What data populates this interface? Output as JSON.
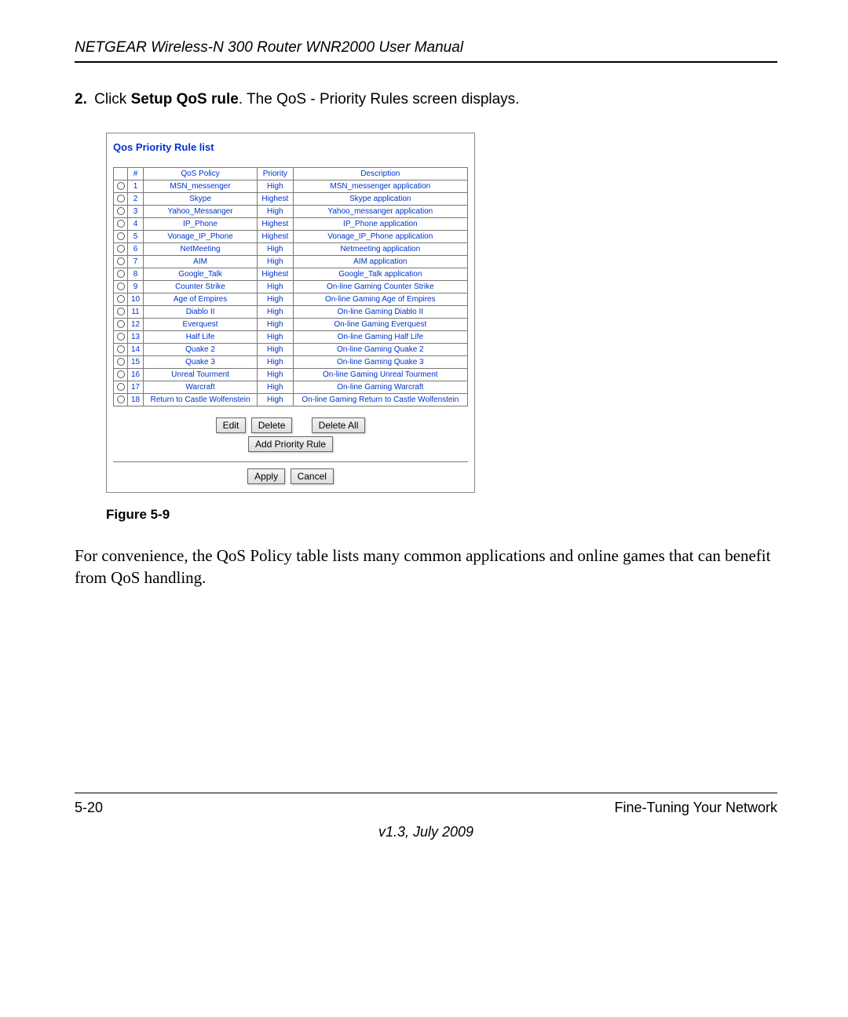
{
  "header": "NETGEAR Wireless-N 300 Router WNR2000 User Manual",
  "step": {
    "number": "2.",
    "lead": "Click ",
    "bold": "Setup QoS rule",
    "rest": ". The QoS - Priority Rules screen displays."
  },
  "panel": {
    "title": "Qos Priority Rule list",
    "columns": {
      "radio": "",
      "num": "#",
      "policy": "QoS Policy",
      "priority": "Priority",
      "desc": "Description"
    },
    "rows": [
      {
        "n": "1",
        "policy": "MSN_messenger",
        "priority": "High",
        "desc": "MSN_messenger application"
      },
      {
        "n": "2",
        "policy": "Skype",
        "priority": "Highest",
        "desc": "Skype application"
      },
      {
        "n": "3",
        "policy": "Yahoo_Messanger",
        "priority": "High",
        "desc": "Yahoo_messanger application"
      },
      {
        "n": "4",
        "policy": "IP_Phone",
        "priority": "Highest",
        "desc": "IP_Phone application"
      },
      {
        "n": "5",
        "policy": "Vonage_IP_Phone",
        "priority": "Highest",
        "desc": "Vonage_IP_Phone application"
      },
      {
        "n": "6",
        "policy": "NetMeeting",
        "priority": "High",
        "desc": "Netmeeting application"
      },
      {
        "n": "7",
        "policy": "AIM",
        "priority": "High",
        "desc": "AIM application"
      },
      {
        "n": "8",
        "policy": "Google_Talk",
        "priority": "Highest",
        "desc": "Google_Talk application"
      },
      {
        "n": "9",
        "policy": "Counter Strike",
        "priority": "High",
        "desc": "On-line Gaming Counter Strike"
      },
      {
        "n": "10",
        "policy": "Age of Empires",
        "priority": "High",
        "desc": "On-line Gaming Age of Empires"
      },
      {
        "n": "11",
        "policy": "Diablo II",
        "priority": "High",
        "desc": "On-line Gaming Diablo II"
      },
      {
        "n": "12",
        "policy": "Everquest",
        "priority": "High",
        "desc": "On-line Gaming Everquest"
      },
      {
        "n": "13",
        "policy": "Half Life",
        "priority": "High",
        "desc": "On-line Gaming Half Life"
      },
      {
        "n": "14",
        "policy": "Quake 2",
        "priority": "High",
        "desc": "On-line Gaming Quake 2"
      },
      {
        "n": "15",
        "policy": "Quake 3",
        "priority": "High",
        "desc": "On-line Gaming Quake 3"
      },
      {
        "n": "16",
        "policy": "Unreal Tourment",
        "priority": "High",
        "desc": "On-line Gaming Unreal Tourment"
      },
      {
        "n": "17",
        "policy": "Warcraft",
        "priority": "High",
        "desc": "On-line Gaming Warcraft"
      },
      {
        "n": "18",
        "policy": "Return to Castle Wolfenstein",
        "priority": "High",
        "desc": "On-line Gaming Return to Castle Wolfenstein"
      }
    ],
    "buttons": {
      "edit": "Edit",
      "delete": "Delete",
      "delete_all": "Delete All",
      "add": "Add Priority Rule",
      "apply": "Apply",
      "cancel": "Cancel"
    }
  },
  "figure_label": "Figure 5-9",
  "paragraph": "For convenience, the QoS Policy table lists many common applications and online games that can benefit from QoS handling.",
  "footer": {
    "left": "5-20",
    "right": "Fine-Tuning Your Network",
    "version": "v1.3, July 2009"
  }
}
